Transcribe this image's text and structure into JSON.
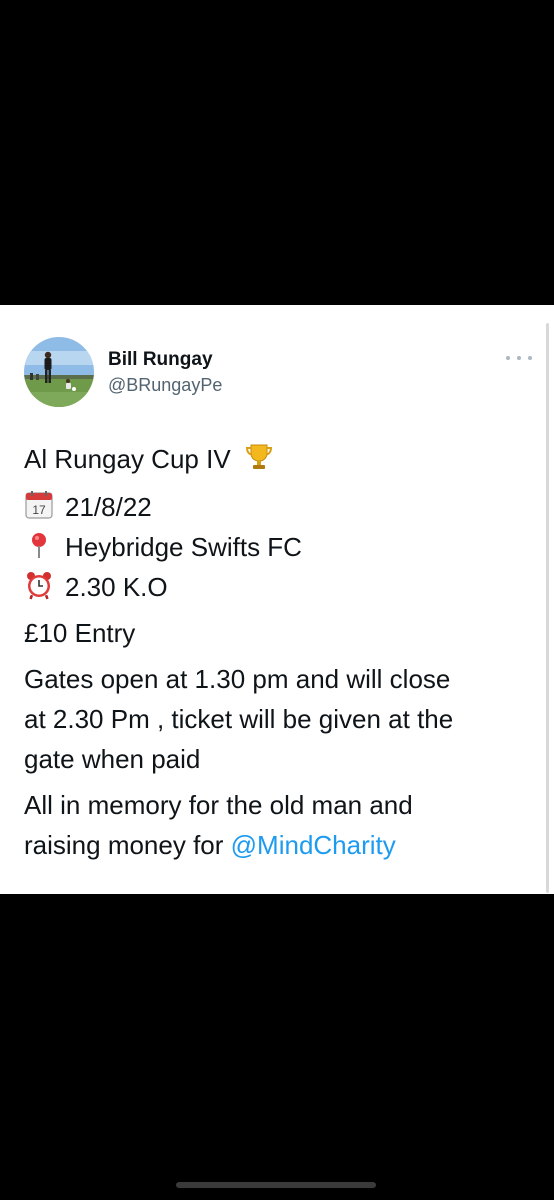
{
  "author": {
    "name": "Bill Rungay",
    "handle": "@BRungayPe"
  },
  "tweet": {
    "title": "Al Rungay Cup IV",
    "details": [
      {
        "icon": "calendar-icon",
        "text": "21/8/22"
      },
      {
        "icon": "pin-icon",
        "text": "Heybridge Swifts FC"
      },
      {
        "icon": "alarm-clock-icon",
        "text": "2.30 K.O"
      }
    ],
    "entry": "£10 Entry",
    "gates": "Gates open at 1.30 pm and will close at 2.30 Pm , ticket will be given at the gate when paid",
    "gates_lines": [
      "Gates open at 1.30 pm and will close",
      "at 2.30 Pm , ticket will be given at the",
      "gate when paid"
    ],
    "memory_lines": [
      "All in memory for the old man and",
      "raising money for "
    ],
    "mention": "@MindCharity",
    "calendar_day": "17"
  },
  "colors": {
    "mention": "#1d9bf0",
    "handle": "#536471",
    "background": "#000000",
    "card": "#ffffff"
  }
}
